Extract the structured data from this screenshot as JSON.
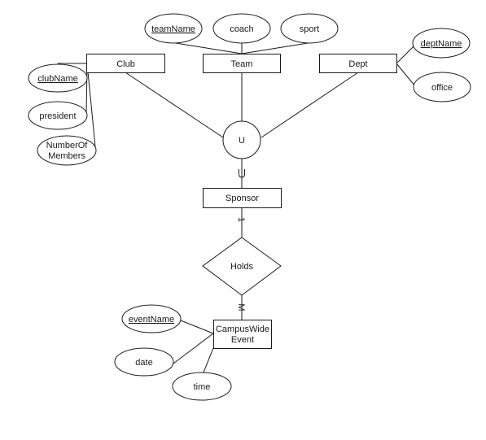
{
  "diagram": {
    "type": "ER diagram",
    "entities": [
      {
        "id": "club",
        "label": "Club"
      },
      {
        "id": "team",
        "label": "Team"
      },
      {
        "id": "dept",
        "label": "Dept"
      },
      {
        "id": "sponsor",
        "label": "Sponsor"
      },
      {
        "id": "event",
        "label_lines": [
          "CampusWide",
          "Event"
        ]
      }
    ],
    "attributes": [
      {
        "id": "clubName",
        "label": "clubName",
        "key": true,
        "entity": "club"
      },
      {
        "id": "president",
        "label": "president",
        "key": false,
        "entity": "club"
      },
      {
        "id": "numberOfMembers",
        "label_lines": [
          "NumberOf",
          "Members"
        ],
        "key": false,
        "entity": "club"
      },
      {
        "id": "teamName",
        "label": "teamName",
        "key": true,
        "entity": "team"
      },
      {
        "id": "coach",
        "label": "coach",
        "key": false,
        "entity": "team"
      },
      {
        "id": "sport",
        "label": "sport",
        "key": false,
        "entity": "team"
      },
      {
        "id": "deptName",
        "label": "deptName",
        "key": true,
        "entity": "dept"
      },
      {
        "id": "office",
        "label": "office",
        "key": false,
        "entity": "dept"
      },
      {
        "id": "eventName",
        "label": "eventName",
        "key": true,
        "entity": "event"
      },
      {
        "id": "date",
        "label": "date",
        "key": false,
        "entity": "event"
      },
      {
        "id": "time",
        "label": "time",
        "key": false,
        "entity": "event"
      }
    ],
    "union": {
      "label": "U",
      "subset_symbol": "U",
      "members": [
        "club",
        "team",
        "dept"
      ],
      "result": "sponsor"
    },
    "relationships": [
      {
        "id": "holds",
        "label": "Holds",
        "from": "sponsor",
        "to": "event",
        "from_cardinality": "1",
        "to_cardinality": "M"
      }
    ]
  }
}
